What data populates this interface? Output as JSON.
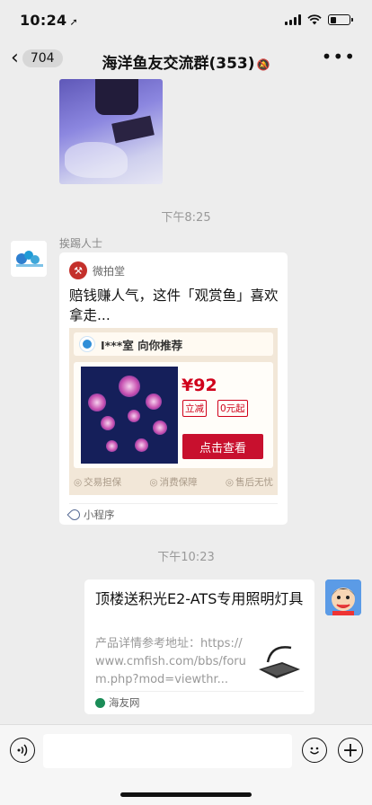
{
  "status_bar": {
    "time": "10:24",
    "location_arrow": "➚"
  },
  "nav": {
    "back_icon": "chevron-left",
    "unread_count": "704",
    "title": "海洋鱼友交流群(353)",
    "mute_icon": "bell-slash",
    "more_icon": "ellipsis"
  },
  "chat": {
    "timestamps": [
      "下午8:25",
      "下午10:23"
    ],
    "miniprogram_message": {
      "sender": "挨踢人士",
      "source_name": "微拍堂",
      "text": "赔钱赚人气，这件「观赏鱼」喜欢拿走...",
      "preview": {
        "shop": "I***室 向你推荐",
        "price": "¥92",
        "tag_1": "立减",
        "tag_2": "0元起",
        "button": "点击查看",
        "guarantees": [
          "交易担保",
          "消费保障",
          "售后无忧"
        ]
      },
      "type_label": "小程序"
    },
    "link_message": {
      "title": "顶楼送积光E2-ATS专用照明灯具",
      "description": "产品详情参考地址：https://www.cmfish.com/bbs/forum.php?mod=viewthr...",
      "source": "海友网"
    }
  },
  "input_bar": {
    "voice_icon": "voice",
    "placeholder": "",
    "emoji_icon": "smile",
    "plus_icon": "plus"
  },
  "colors": {
    "background": "#ededed",
    "accent_red": "#c8102e",
    "link_blue": "#576b95"
  }
}
